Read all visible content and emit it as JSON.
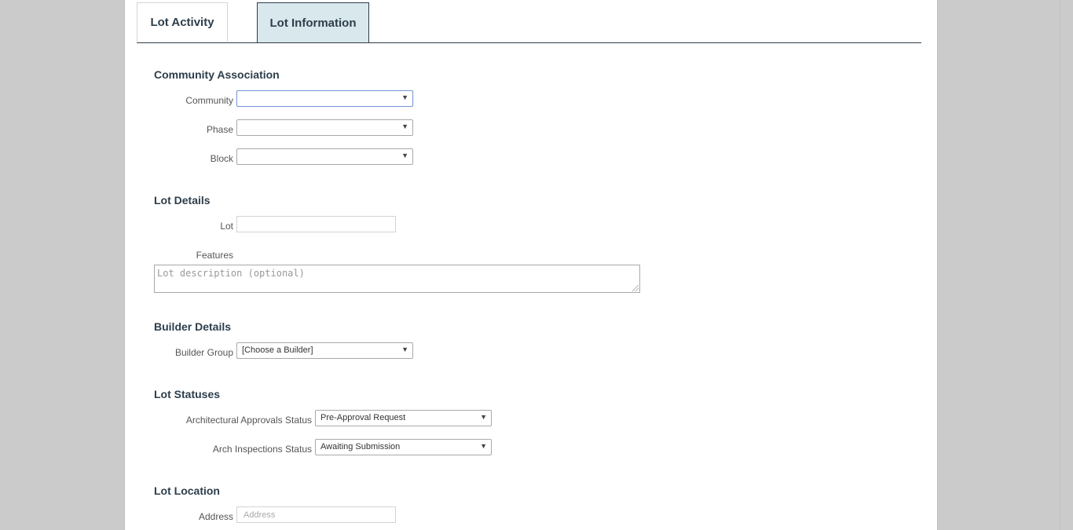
{
  "tabs": [
    {
      "label": "Lot Activity",
      "active": false
    },
    {
      "label": "Lot Information",
      "active": true
    }
  ],
  "community_association": {
    "title": "Community Association",
    "community_label": "Community",
    "community_value": "",
    "phase_label": "Phase",
    "phase_value": "",
    "block_label": "Block",
    "block_value": ""
  },
  "lot_details": {
    "title": "Lot Details",
    "lot_label": "Lot",
    "lot_value": "",
    "features_label": "Features",
    "features_placeholder": "Lot description (optional)"
  },
  "builder_details": {
    "title": "Builder Details",
    "builder_group_label": "Builder Group",
    "builder_group_value": "[Choose a Builder]"
  },
  "lot_statuses": {
    "title": "Lot Statuses",
    "arch_approvals_label": "Architectural Approvals Status",
    "arch_approvals_value": "Pre-Approval Request",
    "arch_inspections_label": "Arch Inspections Status",
    "arch_inspections_value": "Awaiting Submission"
  },
  "lot_location": {
    "title": "Lot Location",
    "address_label": "Address",
    "address_placeholder": "Address"
  },
  "icons": {
    "dropdown_arrow": "chevron-down-icon"
  },
  "colors": {
    "heading": "#2d3e4b",
    "active_tab_bg": "#d8e8ec",
    "page_bg": "#cbcbcb"
  }
}
